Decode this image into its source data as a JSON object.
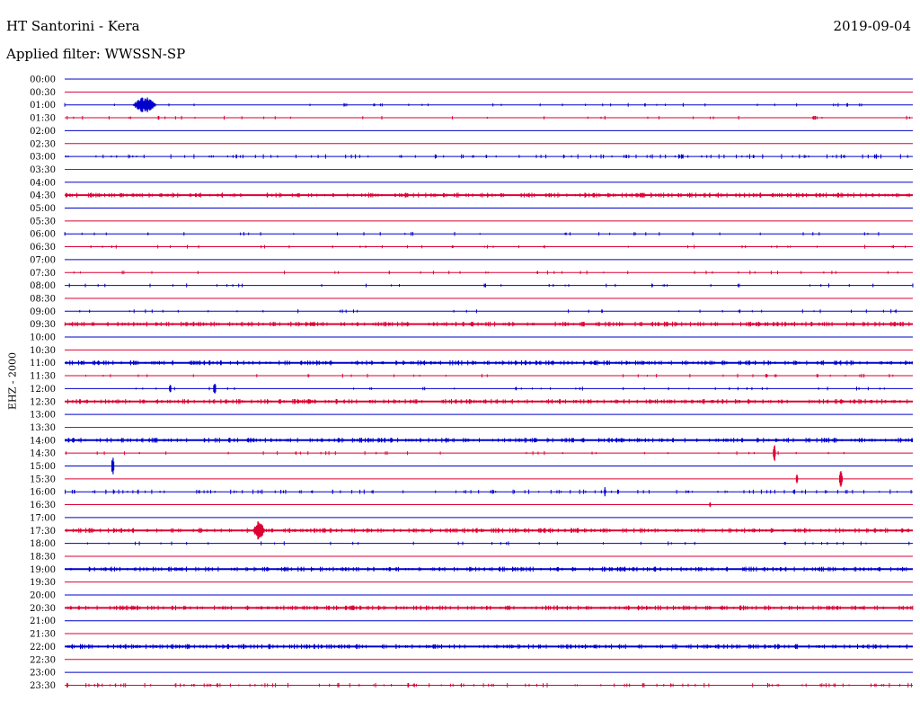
{
  "header": {
    "station": "HT Santorini - Kera",
    "date": "2019-09-04",
    "filter": "Applied filter: WWSSN-SP"
  },
  "channel_label": "EHZ - 2000",
  "colors": {
    "blue": "#0000cc",
    "red": "#dd0033"
  },
  "chart_data": {
    "type": "line",
    "title": "HT Santorini - Kera",
    "ylabel": "EHZ - 2000",
    "xlabel": "",
    "tick_labels": [
      "00:00",
      "00:30",
      "01:00",
      "01:30",
      "02:00",
      "02:30",
      "03:00",
      "03:30",
      "04:00",
      "04:30",
      "05:00",
      "05:30",
      "06:00",
      "06:30",
      "07:00",
      "07:30",
      "08:00",
      "08:30",
      "09:00",
      "09:30",
      "10:00",
      "10:30",
      "11:00",
      "11:30",
      "12:00",
      "12:30",
      "13:00",
      "13:30",
      "14:00",
      "14:30",
      "15:00",
      "15:30",
      "16:00",
      "16:30",
      "17:00",
      "17:30",
      "18:00",
      "18:30",
      "19:00",
      "19:30",
      "20:00",
      "20:30",
      "21:00",
      "21:30",
      "22:00",
      "22:30",
      "23:00",
      "23:30"
    ],
    "trace_colors": [
      "blue",
      "red"
    ],
    "noise_level": [
      0,
      0,
      1,
      1,
      0,
      0,
      2,
      0,
      0,
      3,
      0,
      0,
      1,
      1,
      0,
      1,
      1,
      0,
      1,
      3,
      0,
      0,
      3,
      1,
      1,
      3,
      0,
      0,
      3,
      1,
      0,
      0,
      2,
      0,
      0,
      3,
      1,
      0,
      3,
      0,
      0,
      3,
      0,
      0,
      3,
      0,
      0,
      2
    ],
    "events": [
      {
        "row": "01:00",
        "x": 0.08,
        "amplitude": 8,
        "duration": 0.04
      },
      {
        "row": "12:00",
        "x": 0.175,
        "amplitude": 8,
        "duration": 0.005
      },
      {
        "row": "12:00",
        "x": 0.123,
        "amplitude": 5,
        "duration": 0.004
      },
      {
        "row": "15:00",
        "x": 0.055,
        "amplitude": 11,
        "duration": 0.005
      },
      {
        "row": "14:30",
        "x": 0.835,
        "amplitude": 10,
        "duration": 0.005
      },
      {
        "row": "15:30",
        "x": 0.913,
        "amplitude": 9,
        "duration": 0.006
      },
      {
        "row": "15:30",
        "x": 0.862,
        "amplitude": 6,
        "duration": 0.004
      },
      {
        "row": "16:00",
        "x": 0.636,
        "amplitude": 5,
        "duration": 0.003
      },
      {
        "row": "16:30",
        "x": 0.76,
        "amplitude": 3,
        "duration": 0.003
      },
      {
        "row": "17:30",
        "x": 0.222,
        "amplitude": 10,
        "duration": 0.02
      }
    ]
  }
}
